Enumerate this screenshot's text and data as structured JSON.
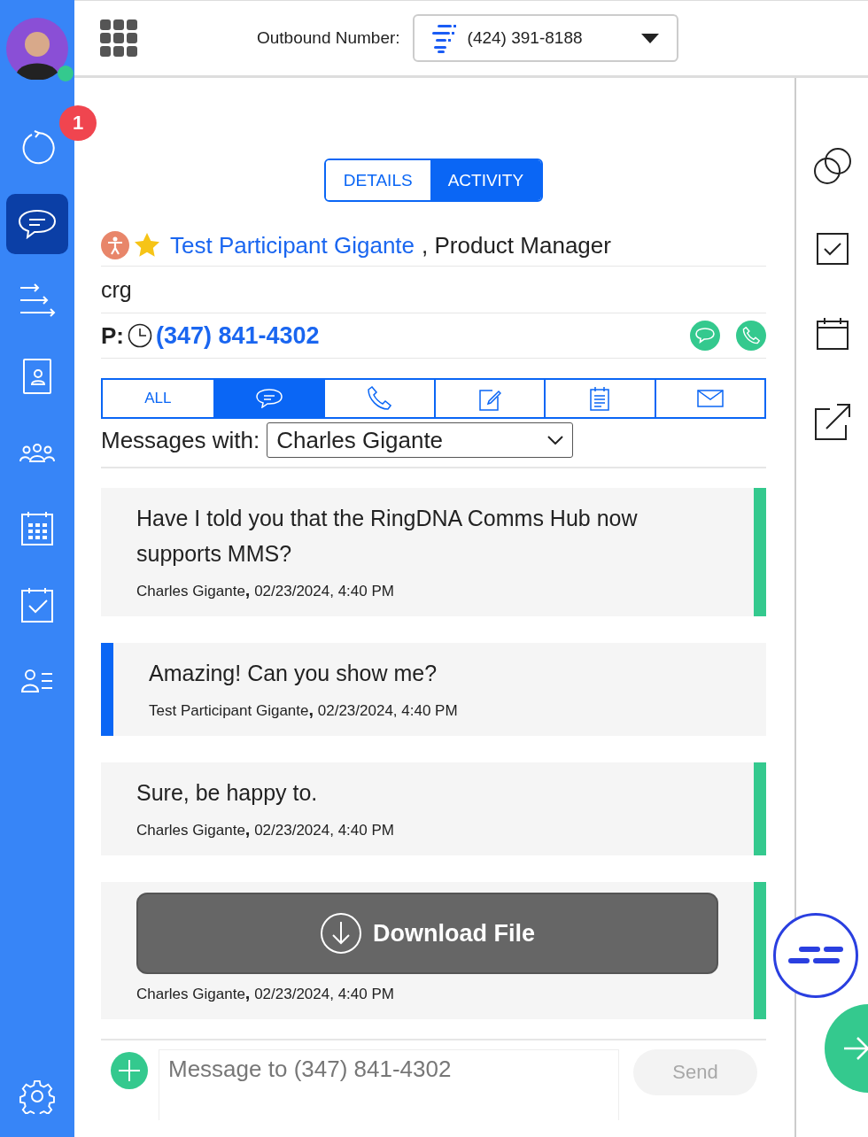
{
  "sidebar": {
    "avatar": {
      "online": true
    },
    "items": [
      {
        "kind": "history",
        "selected": false,
        "badge": "1"
      },
      {
        "kind": "messages",
        "selected": true
      },
      {
        "kind": "cadence",
        "selected": false
      },
      {
        "kind": "contact",
        "selected": false
      },
      {
        "kind": "team",
        "selected": false
      },
      {
        "kind": "calendar",
        "selected": false
      },
      {
        "kind": "tasks",
        "selected": false
      },
      {
        "kind": "people-list",
        "selected": false
      }
    ],
    "bottom_items": [
      {
        "kind": "settings",
        "selected": false
      }
    ]
  },
  "top_bar": {
    "outbound_label": "Outbound Number:",
    "outbound_number": "(424) 391-8188"
  },
  "view_tabs": [
    {
      "label": "DETAILS",
      "selected": false
    },
    {
      "label": "ACTIVITY",
      "selected": true
    }
  ],
  "contact": {
    "starred": true,
    "name": "Test Participant Gigante",
    "title": ", Product Manager",
    "account": "crg",
    "phone_label": "P:",
    "phone": "(347) 841-4302"
  },
  "activity_filters": [
    {
      "kind": "all",
      "label": "ALL",
      "selected": false
    },
    {
      "kind": "sms",
      "selected": true
    },
    {
      "kind": "call",
      "selected": false
    },
    {
      "kind": "note",
      "selected": false
    },
    {
      "kind": "task",
      "selected": false
    },
    {
      "kind": "email",
      "selected": false
    }
  ],
  "messages_with": {
    "label": "Messages with:",
    "value": "Charles Gigante"
  },
  "messages": [
    {
      "outbound": true,
      "kind": "text",
      "text": "Have I told you that the RingDNA Comms Hub now supports MMS?",
      "meta": "Charles Gigante**,** 02/23/2024, 4:40 PM"
    },
    {
      "outbound": false,
      "kind": "text",
      "text": "Amazing! Can you show me?",
      "meta": "Test Participant Gigante**,** 02/23/2024, 4:40 PM"
    },
    {
      "outbound": true,
      "kind": "text",
      "text": "Sure, be happy to.",
      "meta": "Charles Gigante**,** 02/23/2024, 4:40 PM"
    },
    {
      "outbound": true,
      "kind": "file",
      "text": "Download File",
      "meta": "Charles Gigante**,** 02/23/2024, 4:40 PM"
    }
  ],
  "composer": {
    "placeholder": "Message to (347) 841-4302",
    "send": "Send",
    "send_disabled": true
  },
  "right_rail": [
    {
      "kind": "links"
    },
    {
      "kind": "task"
    },
    {
      "kind": "calendar"
    },
    {
      "kind": "open-external"
    }
  ]
}
